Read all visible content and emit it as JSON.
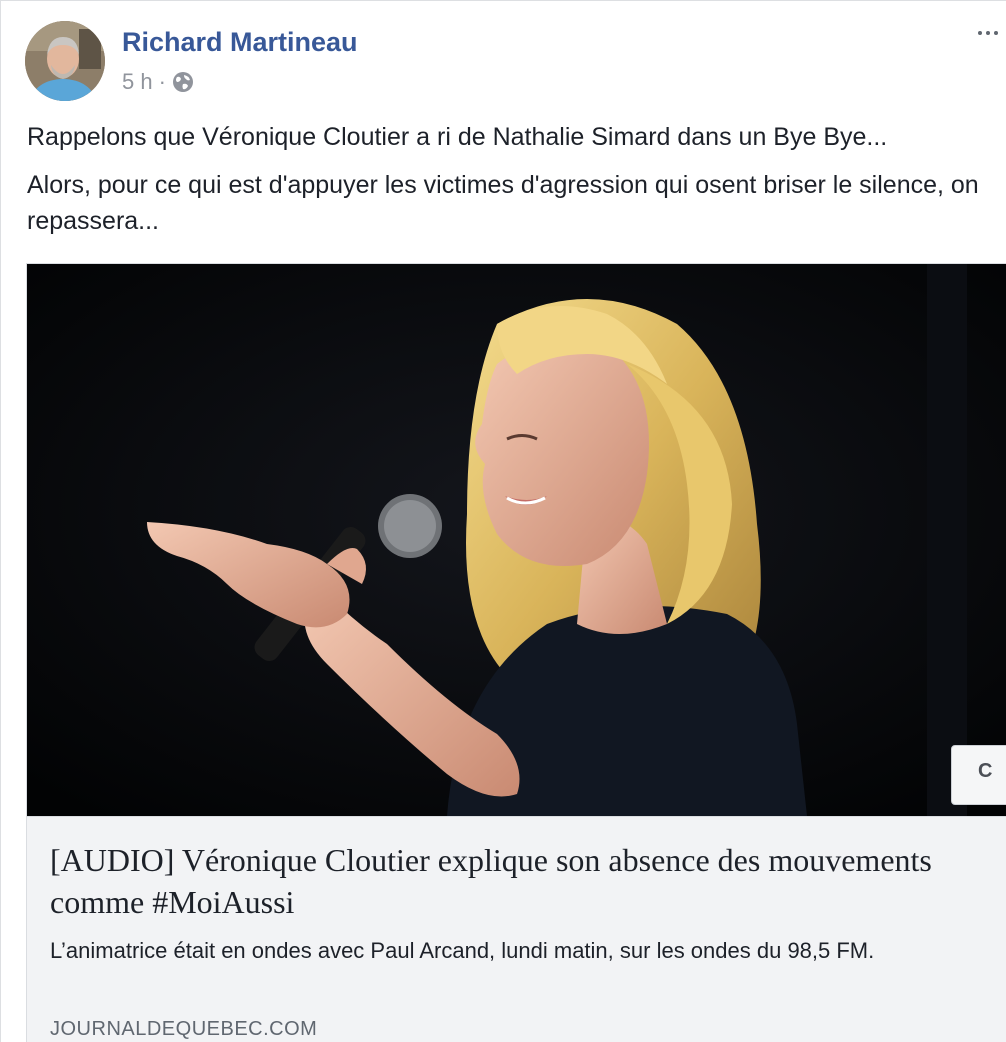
{
  "post": {
    "author": "Richard Martineau",
    "time": "5 h",
    "separator": "·",
    "audience_icon": "globe-icon",
    "menu_icon": "more-options-icon",
    "avatar_icon": "profile-photo",
    "paragraphs": [
      "Rappelons que Véronique Cloutier a ri de Nathalie Simard dans un Bye Bye...",
      "Alors, pour ce qui est d'appuyer les victimes d'agression qui osent briser le silence, on repassera..."
    ]
  },
  "link_card": {
    "image_icon": "article-photo",
    "headline": "[AUDIO] Véronique Cloutier explique son absence des mouvements comme #MoiAussi",
    "description": "L’animatrice était en ondes avec Paul Arcand, lundi matin, sur les ondes du 98,5 FM.",
    "domain": "JOURNALDEQUEBEC.COM",
    "side_button_label": "C"
  },
  "colors": {
    "author_link": "#385898",
    "text": "#1d2129",
    "meta_gray": "#90949c",
    "card_bg": "#f2f3f5",
    "card_border": "#dadde1"
  }
}
